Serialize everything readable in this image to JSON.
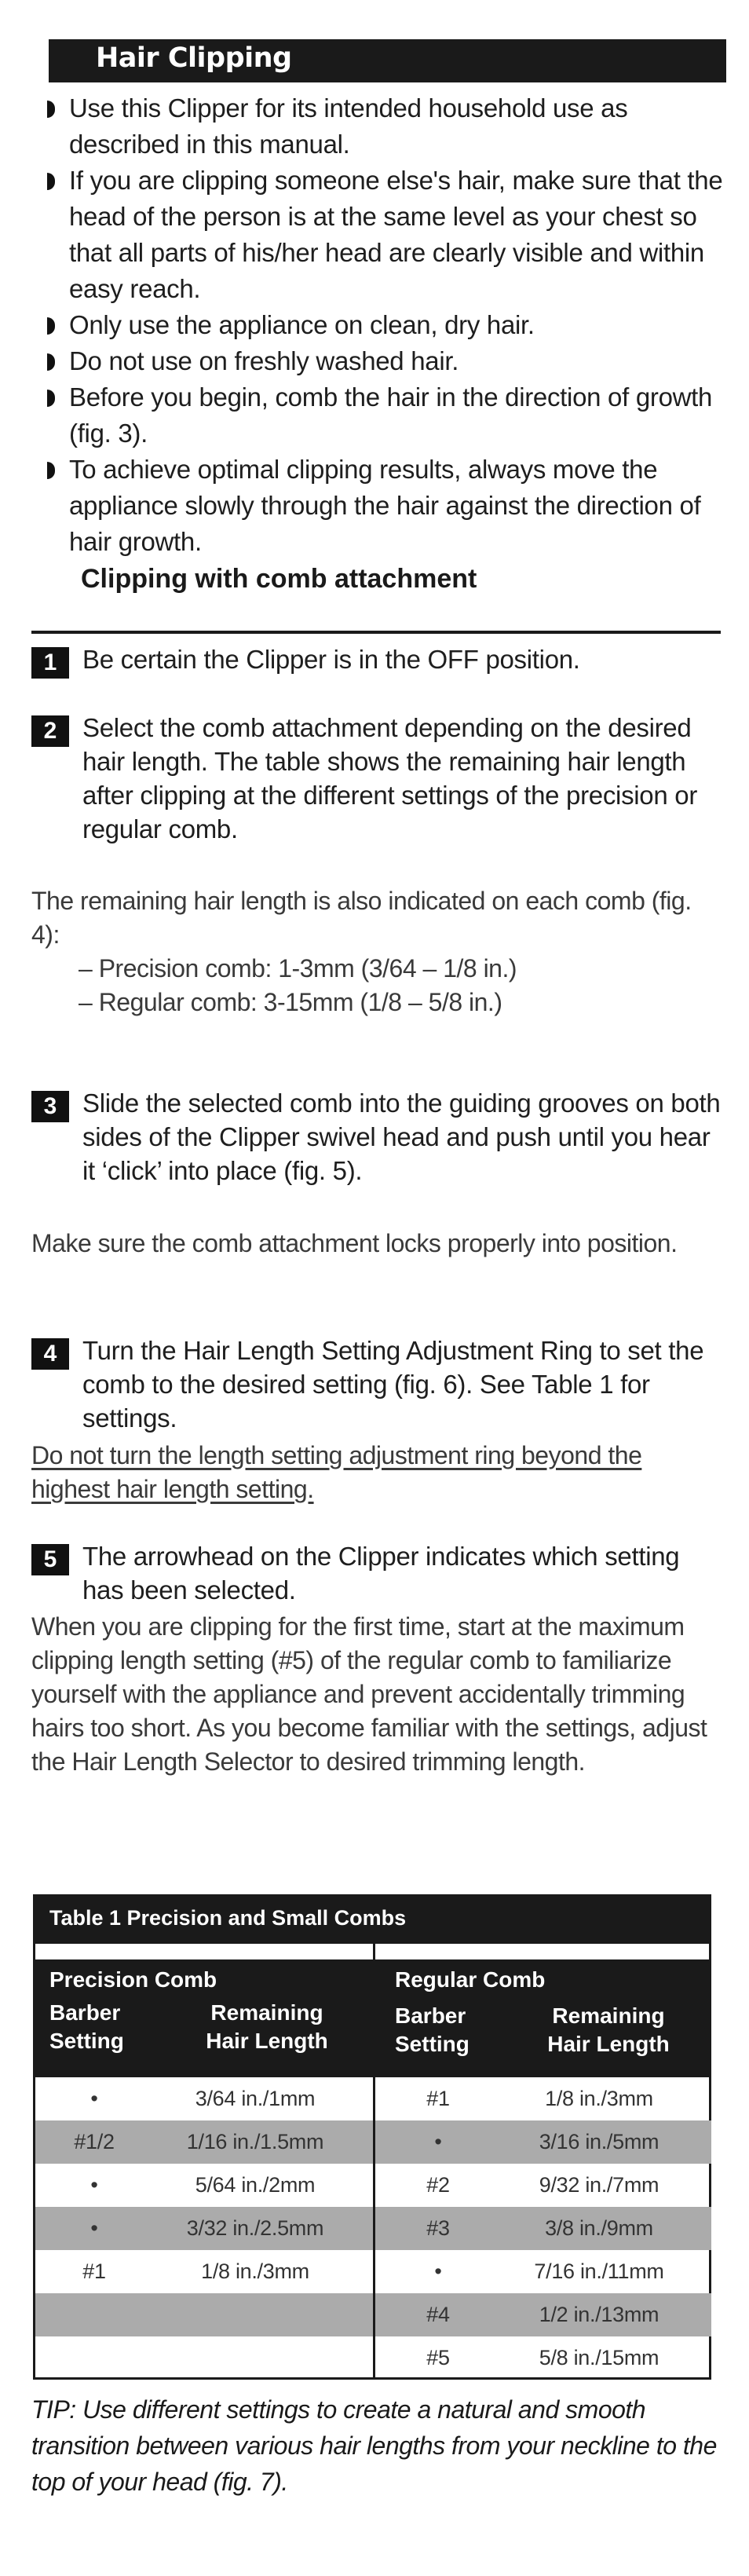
{
  "section": {
    "title": "Hair Clipping"
  },
  "bullets": [
    "Use this Clipper for its intended household use as described in this manual.",
    "If you are clipping someone else's hair, make sure that the head of the person is at the same level as your chest so that all parts of his/her head are clearly visible and within easy reach.",
    "Only use the appliance on clean, dry hair.",
    "Do not use on freshly washed hair.",
    "Before you begin, comb the hair in the direction of growth (fig. 3).",
    "To achieve optimal clipping results, always move the appliance slowly through the hair against the direction of hair growth."
  ],
  "subsection": {
    "title": "Clipping with comb attachment"
  },
  "steps": [
    {
      "number": "1",
      "text": "Be certain the Clipper is in the OFF position."
    },
    {
      "number": "2",
      "text": "Select the comb attachment depending on the desired hair length. The table shows the remaining hair length after clipping at the different settings of the precision or regular comb."
    },
    {
      "number": "3",
      "text": "Slide the selected comb into the guiding grooves on both sides of the Clipper swivel head and push until you hear it ‘click’ into place (fig. 5)."
    },
    {
      "number": "4",
      "text": "Turn the Hair Length Setting Adjustment Ring to set the comb to the desired setting (fig. 6). See Table 1 for settings."
    },
    {
      "number": "5",
      "text": "The arrowhead on the Clipper indicates which setting has been selected."
    }
  ],
  "notes": {
    "step2": "The remaining hair length is also indicated on each comb (fig. 4):",
    "step2_items": [
      "– Precision comb: 1-3mm (3/64 – 1/8 in.)",
      "– Regular comb: 3-15mm (1/8 – 5/8 in.)"
    ],
    "step3": "Make sure the comb attachment locks properly into position.",
    "step4_warning": "Do not turn the length setting adjustment ring beyond the highest hair length setting.",
    "step5": "When you are clipping for the first time, start at the maximum clipping length setting (#5) of the regular comb to familiarize yourself with the appliance and prevent accidentally trimming hairs too short. As you become familiar with the settings, adjust the Hair Length Selector to desired trimming length."
  },
  "table": {
    "caption": "Table 1 Precision and Small Combs",
    "groups": [
      {
        "name": "Precision Comb",
        "col1_header": [
          "Barber",
          "Setting"
        ],
        "col2_header": [
          "Remaining",
          "Hair Length"
        ],
        "rows": [
          {
            "setting": "•",
            "length": "3/64 in./1mm"
          },
          {
            "setting": "#1/2",
            "length": "1/16 in./1.5mm"
          },
          {
            "setting": "•",
            "length": "5/64 in./2mm"
          },
          {
            "setting": "•",
            "length": "3/32 in./2.5mm"
          },
          {
            "setting": "#1",
            "length": "1/8 in./3mm"
          },
          {
            "setting": "",
            "length": ""
          },
          {
            "setting": "",
            "length": ""
          }
        ]
      },
      {
        "name": "Regular Comb",
        "col1_header": [
          "Barber",
          "Setting"
        ],
        "col2_header": [
          "Remaining",
          "Hair Length"
        ],
        "rows": [
          {
            "setting": "#1",
            "length": "1/8 in./3mm"
          },
          {
            "setting": "•",
            "length": "3/16 in./5mm"
          },
          {
            "setting": "#2",
            "length": "9/32 in./7mm"
          },
          {
            "setting": "#3",
            "length": "3/8 in./9mm"
          },
          {
            "setting": "•",
            "length": "7/16 in./11mm"
          },
          {
            "setting": "#4",
            "length": "1/2 in./13mm"
          },
          {
            "setting": "#5",
            "length": "5/8 in./15mm"
          }
        ]
      }
    ]
  },
  "tip": "TIP: Use different settings to create a natural and smooth transition between various hair lengths from your neckline to the top of your head (fig. 7).",
  "colors": {
    "bar": "#1a1a1a",
    "row_alt": "#ababab",
    "text": "#1e1e1e"
  }
}
